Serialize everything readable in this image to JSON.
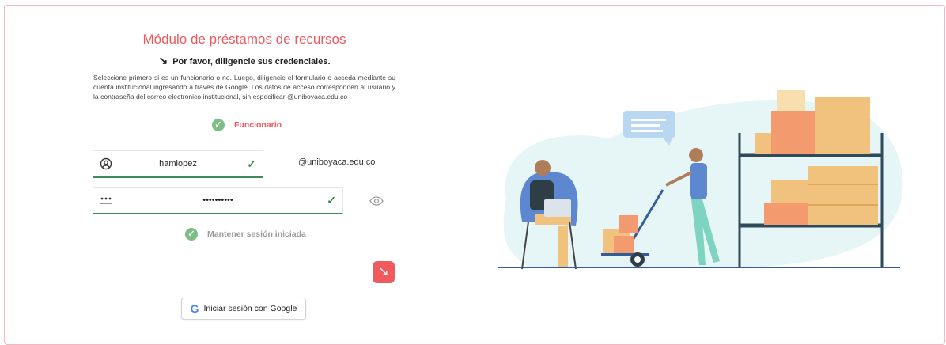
{
  "header": {
    "title": "Módulo de préstamos de recursos",
    "subtitle": "Por favor, diligencie sus credenciales.",
    "subtitle_icon": "arrow-down-right-icon"
  },
  "instructions": "Seleccione primero si es un funcionario o no. Luego, diligencie el formulario o acceda mediante su cuenta institucional ingresando a través de Google. Los datos de acceso corresponden al usuario y la contraseña del correo electrónico institucional, sin especificar @uniboyaca.edu.co",
  "funcionario": {
    "label": "Funcionario",
    "checked": true
  },
  "username": {
    "value": "hamlopez",
    "domain_suffix": "@uniboyaca.edu.co",
    "valid": true
  },
  "password": {
    "value": "••••••••••",
    "valid": true
  },
  "keep_session": {
    "label": "Mantener sesión iniciada",
    "checked": true
  },
  "submit": {
    "icon": "arrow-down-right-icon"
  },
  "google_login": {
    "label": "Iniciar sesión con Google"
  },
  "colors": {
    "accent": "#ef5a5f",
    "success": "#7bbf86",
    "valid_border": "#3e8a5a"
  }
}
